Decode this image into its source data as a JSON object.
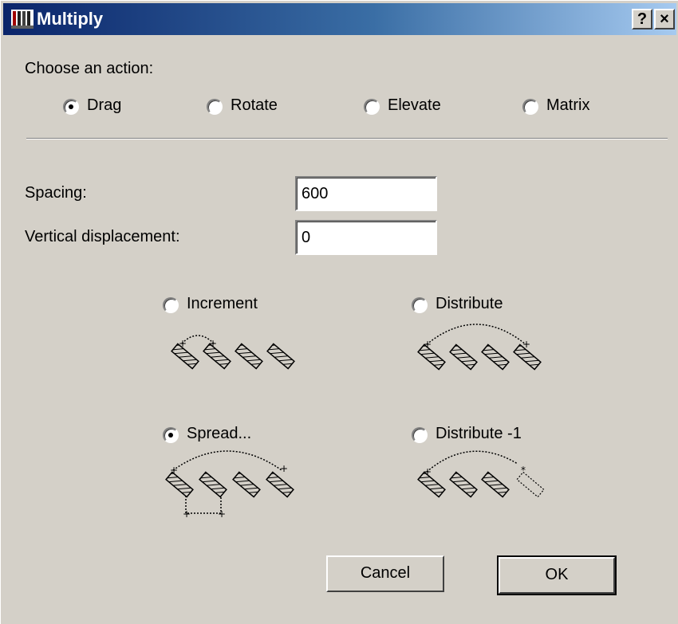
{
  "window": {
    "title": "Multiply",
    "help_label": "?",
    "close_label": "×"
  },
  "action": {
    "label": "Choose an action:",
    "options": [
      {
        "label": "Drag",
        "selected": true
      },
      {
        "label": "Rotate",
        "selected": false
      },
      {
        "label": "Elevate",
        "selected": false
      },
      {
        "label": "Matrix",
        "selected": false
      }
    ]
  },
  "fields": {
    "spacing": {
      "label": "Spacing:",
      "value": "600"
    },
    "vertical": {
      "label": "Vertical displacement:",
      "value": "0"
    }
  },
  "modes": [
    {
      "label": "Increment",
      "selected": false,
      "icon": "increment-diagram-icon"
    },
    {
      "label": "Distribute",
      "selected": false,
      "icon": "distribute-diagram-icon"
    },
    {
      "label": "Spread...",
      "selected": true,
      "icon": "spread-diagram-icon"
    },
    {
      "label": "Distribute -1",
      "selected": false,
      "icon": "distribute-minus-one-diagram-icon"
    }
  ],
  "buttons": {
    "cancel": "Cancel",
    "ok": "OK"
  }
}
